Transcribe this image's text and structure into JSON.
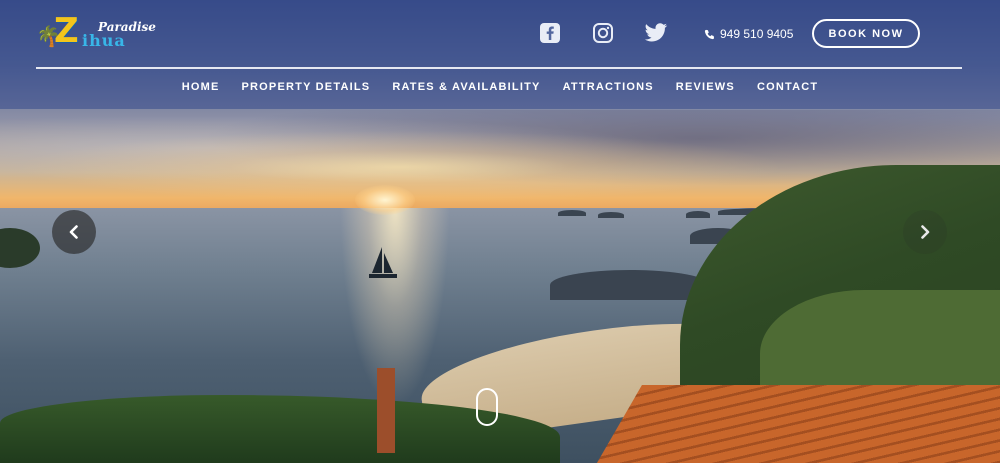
{
  "brand": {
    "logo_letter": "Z",
    "logo_top": "Paradise",
    "logo_bottom": "ihua"
  },
  "header": {
    "social": [
      {
        "icon": "facebook-icon"
      },
      {
        "icon": "instagram-icon"
      },
      {
        "icon": "twitter-icon"
      }
    ],
    "phone": "949 510 9405",
    "book_label": "BOOK NOW"
  },
  "nav": {
    "items": [
      "HOME",
      "PROPERTY DETAILS",
      "RATES & AVAILABILITY",
      "ATTRACTIONS",
      "REVIEWS",
      "CONTACT"
    ]
  },
  "slider": {
    "prev_icon": "chevron-left-icon",
    "next_icon": "chevron-right-icon",
    "indicator_icon": "scroll-indicator-icon"
  },
  "colors": {
    "header_bg": "#34488c",
    "logo_yellow": "#f3c51c",
    "logo_blue": "#38b6e8",
    "text": "#ffffff"
  }
}
